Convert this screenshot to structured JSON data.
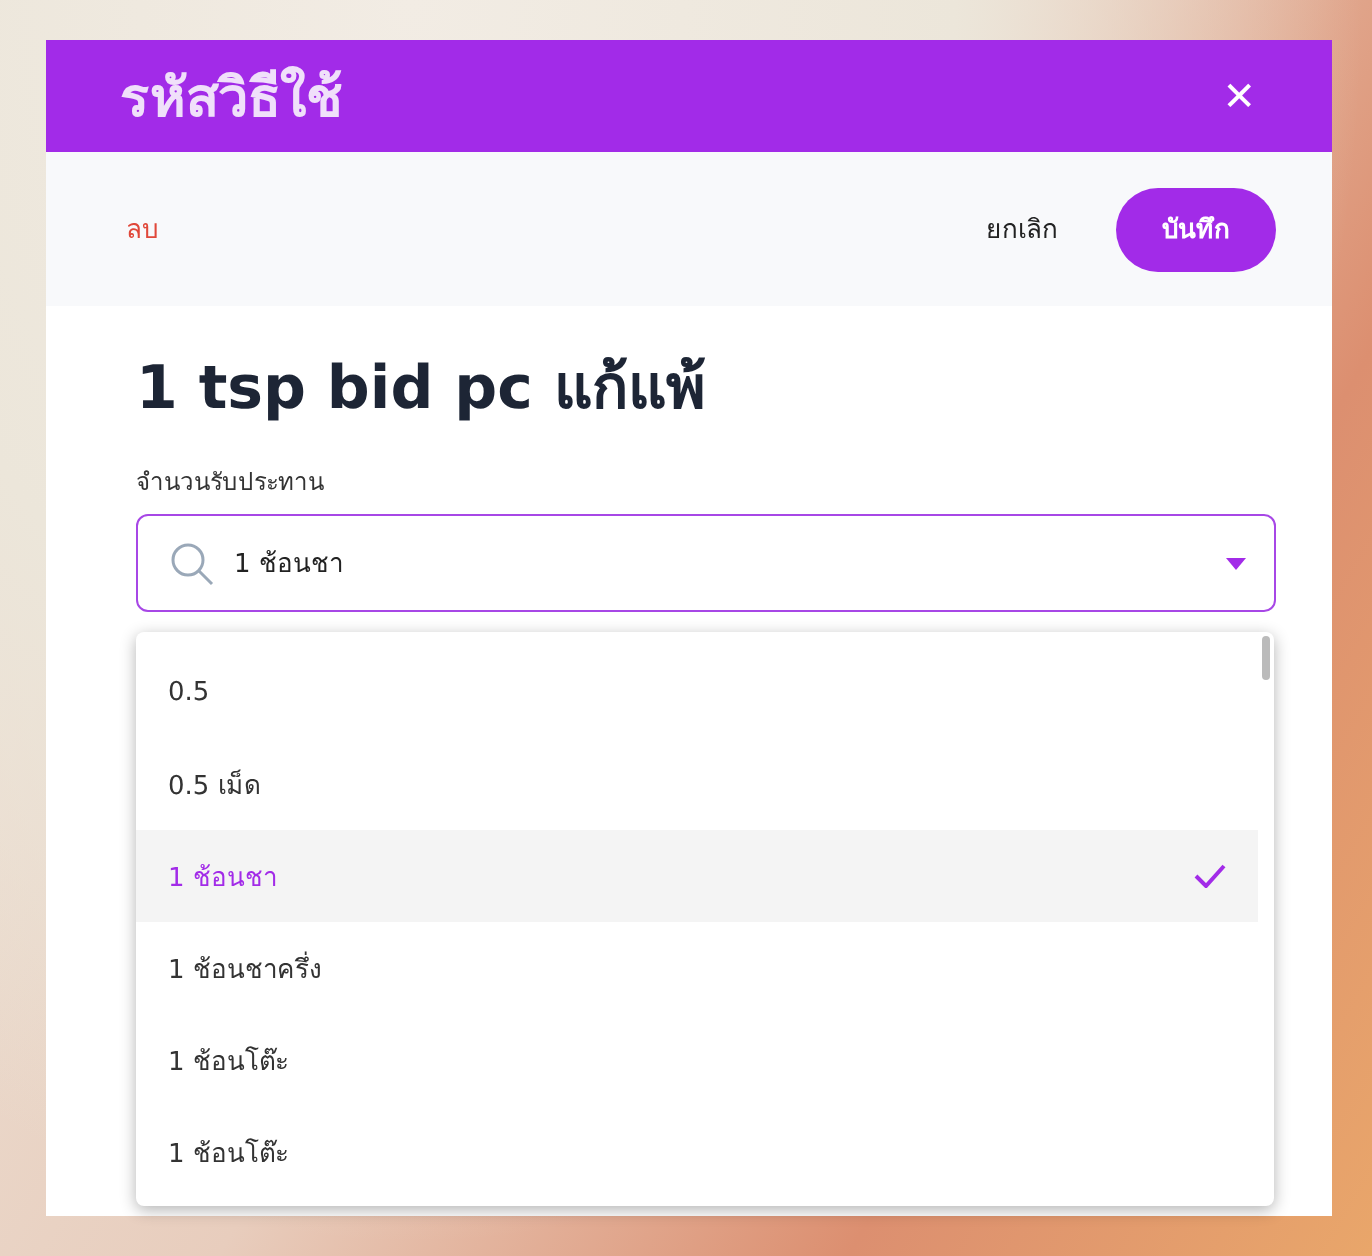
{
  "dialog": {
    "title": "รหัสวิธีใช้",
    "close_icon": "✕"
  },
  "toolbar": {
    "delete": "ลบ",
    "cancel": "ยกเลิก",
    "save": "บันทึก"
  },
  "recipe_title": "1 tsp bid pc แก้แพ้",
  "serving_field": {
    "label": "จำนวนรับประทาน",
    "value": "1 ช้อนชา",
    "expanded": true
  },
  "options": [
    {
      "label": "0.5",
      "selected": false
    },
    {
      "label": "0.5 เม็ด",
      "selected": false
    },
    {
      "label": "1 ช้อนชา",
      "selected": true
    },
    {
      "label": "1 ช้อนชาครึ่ง",
      "selected": false
    },
    {
      "label": "1 ช้อนโต๊ะ",
      "selected": false
    },
    {
      "label": "1 ช้อนโต๊ะ",
      "selected": false
    }
  ]
}
